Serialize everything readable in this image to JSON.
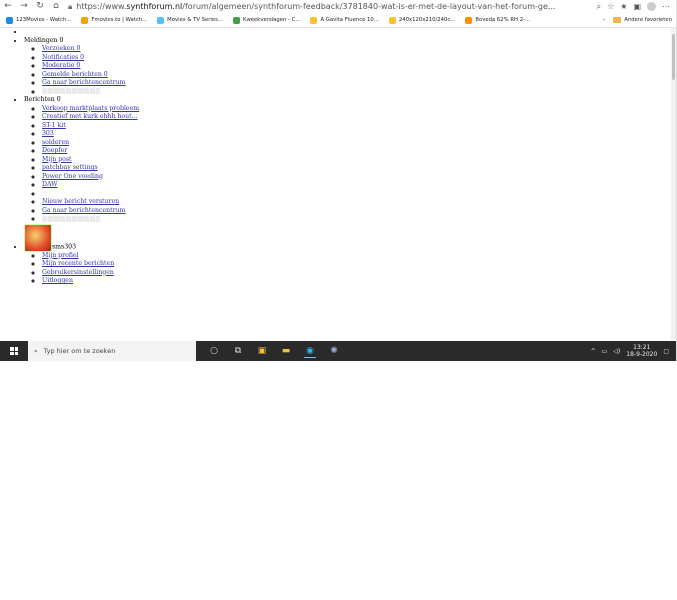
{
  "browser": {
    "url_prefix": "https://www.",
    "url_host": "synthforum.nl",
    "url_path": "/forum/algemeen/synthforum-feedback/3781840-wat-is-er-met-de-layout-van-het-forum-ge...",
    "bookmarks": [
      {
        "label": "123Movies - Watch...",
        "color": "#1e88e5"
      },
      {
        "label": "Fmovies.to | Watch...",
        "color": "#f4a300"
      },
      {
        "label": "Movies & TV Series...",
        "color": "#4fc3f7"
      },
      {
        "label": "Kweekverslagen - C...",
        "color": "#43a047"
      },
      {
        "label": "A Gavita Fluence 10...",
        "color": "#fbc02d"
      },
      {
        "label": "240x120x210/240c...",
        "color": "#fbc02d"
      },
      {
        "label": "Boveda 62% RH 2-...",
        "color": "#ff8f00"
      }
    ],
    "other_favorites": "Andere favorieten"
  },
  "page": {
    "meldingen": {
      "label": "Meldingen",
      "count": "0",
      "items": [
        "Verzoeken 0",
        "Notificaties 0",
        "Moderatie 0",
        "Gemelde berichten 0",
        "Ga naar berichtencentrum"
      ]
    },
    "berichten": {
      "label": "Berichten",
      "count": "0",
      "items": [
        "Verkoop marktplaats probleem",
        "Creatief met kurk ehhh hout...",
        "ST-1 kit",
        "303",
        "solderen",
        "Doepfer",
        "Mijn post",
        "patchbay settings",
        "Power One voeding",
        "DAW"
      ],
      "actions": [
        "Nieuw bericht versturen",
        "Ga naar berichtencentrum"
      ]
    },
    "user": {
      "name": "sms303",
      "items": [
        "Mijn profiel",
        "Mijn recente berichten",
        "Gebruikersinstellingen",
        "Uitloggen"
      ]
    }
  },
  "taskbar": {
    "search_placeholder": "Typ hier om te zoeken",
    "time": "13:21",
    "date": "18-9-2020"
  }
}
